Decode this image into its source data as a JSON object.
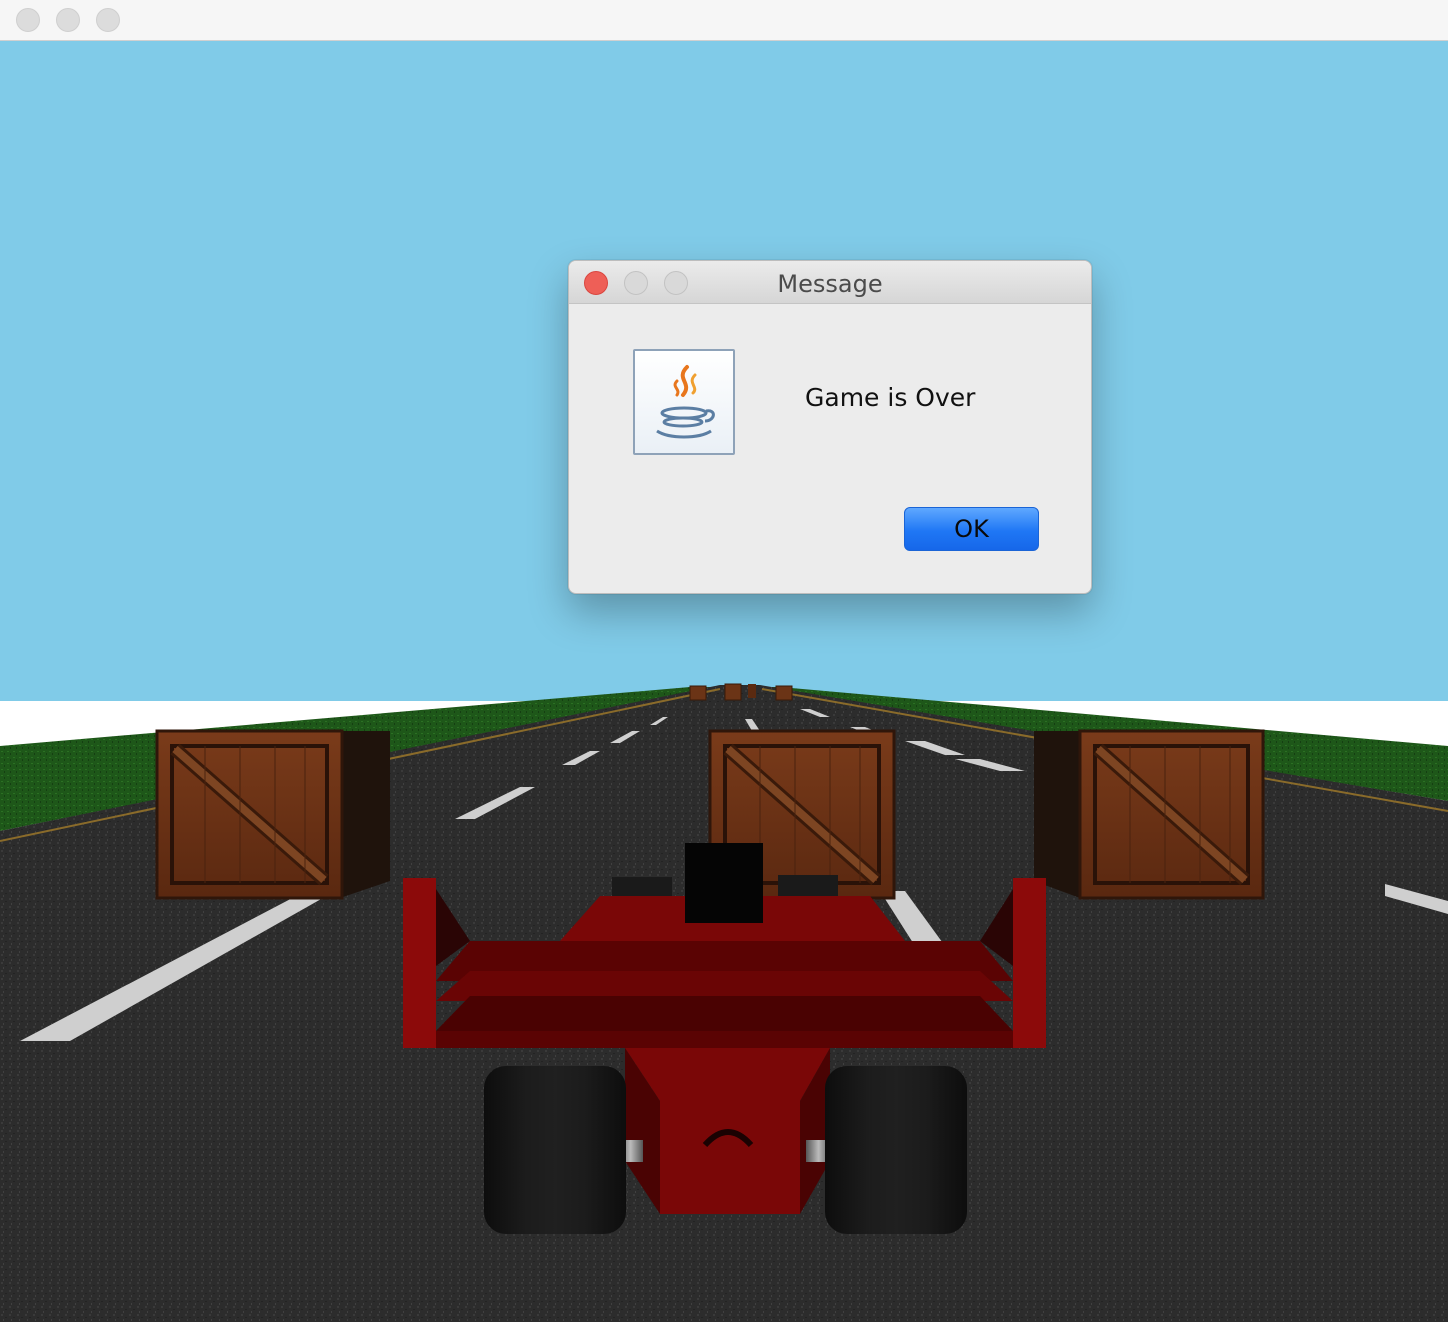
{
  "window": {
    "title": ""
  },
  "colors": {
    "sky": "#80cbe8",
    "grass": "#1f5a1a",
    "road": "#2e2e2e",
    "lane_marking": "#d0d0d0",
    "crate": "#6b3416",
    "car_body": "#7a0707",
    "tire": "#151515"
  },
  "dialog": {
    "title": "Message",
    "message": "Game is Over",
    "icon": "java-cup-icon",
    "ok_label": "OK",
    "accent": "#1f77f5"
  }
}
